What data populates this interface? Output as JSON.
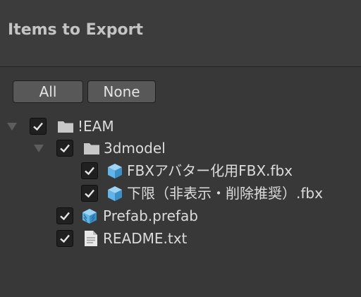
{
  "header": {
    "title": "Items to Export"
  },
  "buttons": {
    "all_label": "All",
    "none_label": "None"
  },
  "tree": {
    "items": [
      {
        "label": "!EAM",
        "icon": "folder-icon",
        "checked": true,
        "expanded": true,
        "depth": 0
      },
      {
        "label": "3dmodel",
        "icon": "folder-icon",
        "checked": true,
        "expanded": true,
        "depth": 1
      },
      {
        "label": "FBXアバター化用FBX.fbx",
        "icon": "model-cube-icon",
        "checked": true,
        "depth": 2
      },
      {
        "label": "下限（非表示・削除推奨）.fbx",
        "icon": "model-cube-icon",
        "checked": true,
        "depth": 2
      },
      {
        "label": "Prefab.prefab",
        "icon": "prefab-cube-icon",
        "checked": true,
        "depth": 1
      },
      {
        "label": "README.txt",
        "icon": "text-file-icon",
        "checked": true,
        "depth": 1
      }
    ]
  },
  "colors": {
    "background": "#383838",
    "header_background": "#3c3c3c",
    "button_background": "#585858",
    "checkbox_background": "#202020",
    "folder_icon": "#c8c8c8",
    "cube_icon": "#5fb4e8"
  }
}
